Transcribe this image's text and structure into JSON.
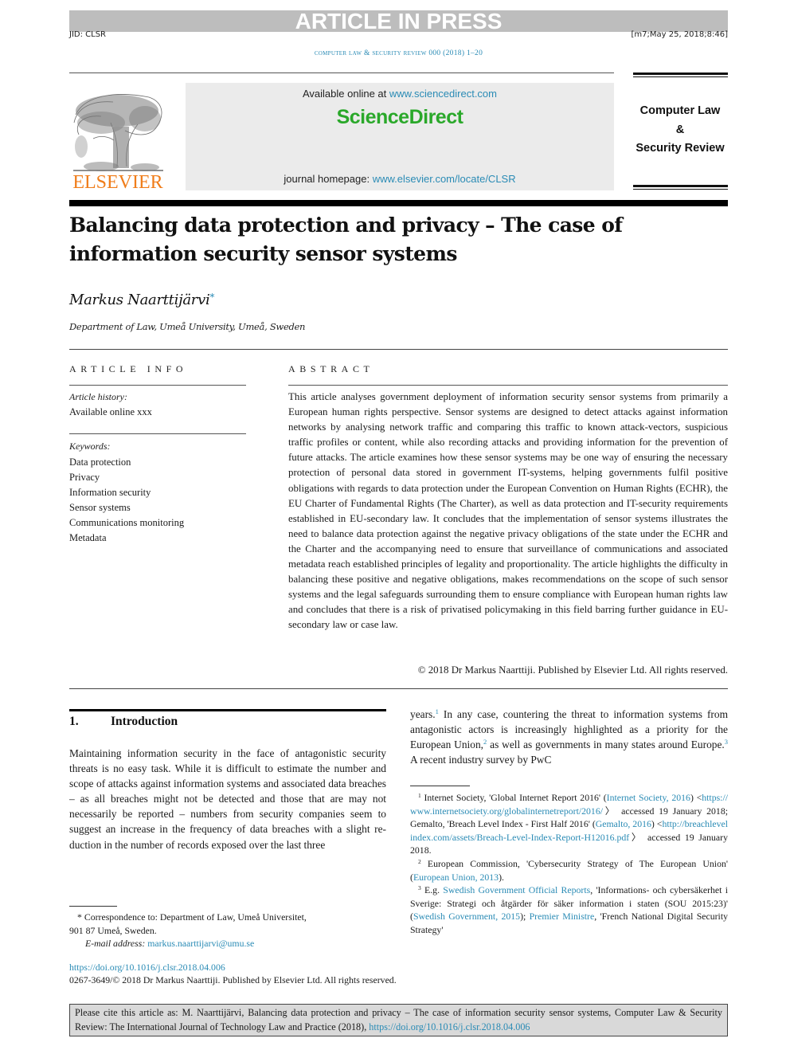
{
  "banner": {
    "status": "ARTICLE IN PRESS",
    "jid": "JID: CLSR",
    "stamp": "[m7;May 25, 2018;8:46]",
    "running_head": "computer law & security review 000 (2018) 1–20"
  },
  "masthead": {
    "publisher_logo_text": "ELSEVIER",
    "available_prefix": "Available online at ",
    "available_link": "www.sciencedirect.com",
    "platform_name": "ScienceDirect",
    "homepage_prefix": "journal homepage: ",
    "homepage_link": "www.elsevier.com/locate/CLSR",
    "journal_name_line1": "Computer Law",
    "journal_name_line2": "&",
    "journal_name_line3": "Security Review",
    "colors": {
      "elsevier_orange": "#f07d1a",
      "sciencedirect_green": "#2aa82a",
      "link_blue": "#2a8bb5",
      "banner_gray": "#bdbdbd"
    }
  },
  "article": {
    "title_line1": "Balancing data protection and privacy – The case of",
    "title_line2": "information security sensor systems",
    "author": "Markus Naarttijärvi",
    "author_marker": "*",
    "affiliation": "Department of Law, Umeå University, Umeå, Sweden"
  },
  "article_info": {
    "heading": "ARTICLE INFO",
    "history_label": "Article history:",
    "history_value": "Available online xxx",
    "keywords_label": "Keywords:",
    "keywords": [
      "Data protection",
      "Privacy",
      "Information security",
      "Sensor systems",
      "Communications monitoring",
      "Metadata"
    ]
  },
  "abstract": {
    "heading": "ABSTRACT",
    "text": "This article analyses government deployment of information security sensor systems from primarily a European human rights perspective. Sensor systems are designed to detect at­tacks against information networks by analysing network traffic and comparing this traffic to known attack-vectors, suspicious traffic profiles or content, while also recording attacks and providing information for the prevention of future attacks. The article examines how these sensor systems may be one way of ensuring the necessary protection of personal data stored in government IT-systems, helping governments fulfil positive obligations with regards to data protection under the European Convention on Human Rights (ECHR), the EU Charter of Fundamental Rights (The Charter), as well as data protection and IT-security re­quirements established in EU-secondary law. It concludes that the implementation of sensor systems illustrates the need to balance data protection against the negative privacy obliga­tions of the state under the ECHR and the Charter and the accompanying need to ensure that surveillance of communications and associated metadata reach established principles of legality and proportionality. The article highlights the difficulty in balancing these posi­tive and negative obligations, makes recommendations on the scope of such sensor systems and the legal safeguards surrounding them to ensure compliance with European human rights law and concludes that there is a risk of privatised policymaking in this field barring further guidance in EU-secondary law or case law.",
    "copyright": "© 2018 Dr Markus Naarttiji. Published by Elsevier Ltd. All rights reserved."
  },
  "body": {
    "section_number": "1.",
    "section_title": "Introduction",
    "left_paragraph": "Maintaining information security in the face of antagonistic security threats is no easy task. While it is difficult to esti­mate the number and scope of attacks against information systems and associated data breaches – as all breaches might not be detected and those that are may not necessarily be re­ported – numbers from security companies seem to suggest an increase in the frequency of data breaches with a slight re­duction in the number of records exposed over the last three",
    "right_seg1": "years.",
    "right_fn1": "1",
    "right_seg2": " In any case, countering the threat to information sys­tems from antagonistic actors is increasingly highlighted as a priority for the European Union,",
    "right_fn2": "2",
    "right_seg3": " as well as governments in many states around Europe.",
    "right_fn3": "3",
    "right_seg4": " A recent industry survey by PwC"
  },
  "footnotes": {
    "fn1": {
      "num": "1",
      "t1": " Internet Society, 'Global Internet Report 2016' (",
      "l1": "Internet Soci­ety, 2016",
      "t2": ") <",
      "l2": "https://www.internetsociety.org/globalinternetreport/2016/",
      "t3": "〉 accessed 19 January 2018; Gemalto, 'Breach Level Index - First Half 2016' (",
      "l3": "Gemalto, 2016",
      "t4": ") <",
      "l4": "http://breachlevelindex.com/assets/Breach-Level-Index-Report-H12016.pdf",
      "t5": "〉 accessed 19 Jan­uary 2018."
    },
    "fn2": {
      "num": "2",
      "t1": " European Commission, 'Cybersecurity Strategy of The Euro­pean Union' (",
      "l1": "European Union, 2013",
      "t2": ")."
    },
    "fn3": {
      "num": "3",
      "t1": " E.g. ",
      "l1": "Swedish Government Official Reports",
      "t2": ", 'Informations- och cybersäkerhet i Sverige: Strategi och åtgärder för säker infor­mation i staten (SOU 2015:23)' (",
      "l2": "Swedish Government, 2015",
      "t3": "); ",
      "l3": "Premier Ministre",
      "t4": ", 'French National Digital Security Strategy'"
    },
    "corr_marker": "*",
    "corr_text": " Correspondence to: Department of Law, Umeå Universitet,",
    "corr_text2": "901 87 Umeå, Sweden.",
    "email_label": "E-mail address:",
    "email": "markus.naarttijarvi@umu.se",
    "doi": "https://doi.org/10.1016/j.clsr.2018.04.006",
    "issn_line": "0267-3649/© 2018 Dr Markus Naarttiji. Published by Elsevier Ltd. All rights reserved."
  },
  "cite_box": {
    "text": "Please cite this article as: M. Naarttijärvi, Balancing data protection and privacy – The case of information security sensor systems, Com­puter Law & Security Review: The International Journal of Technology Law and Practice (2018), ",
    "link": "https://doi.org/10.1016/j.clsr.2018.04.006"
  }
}
